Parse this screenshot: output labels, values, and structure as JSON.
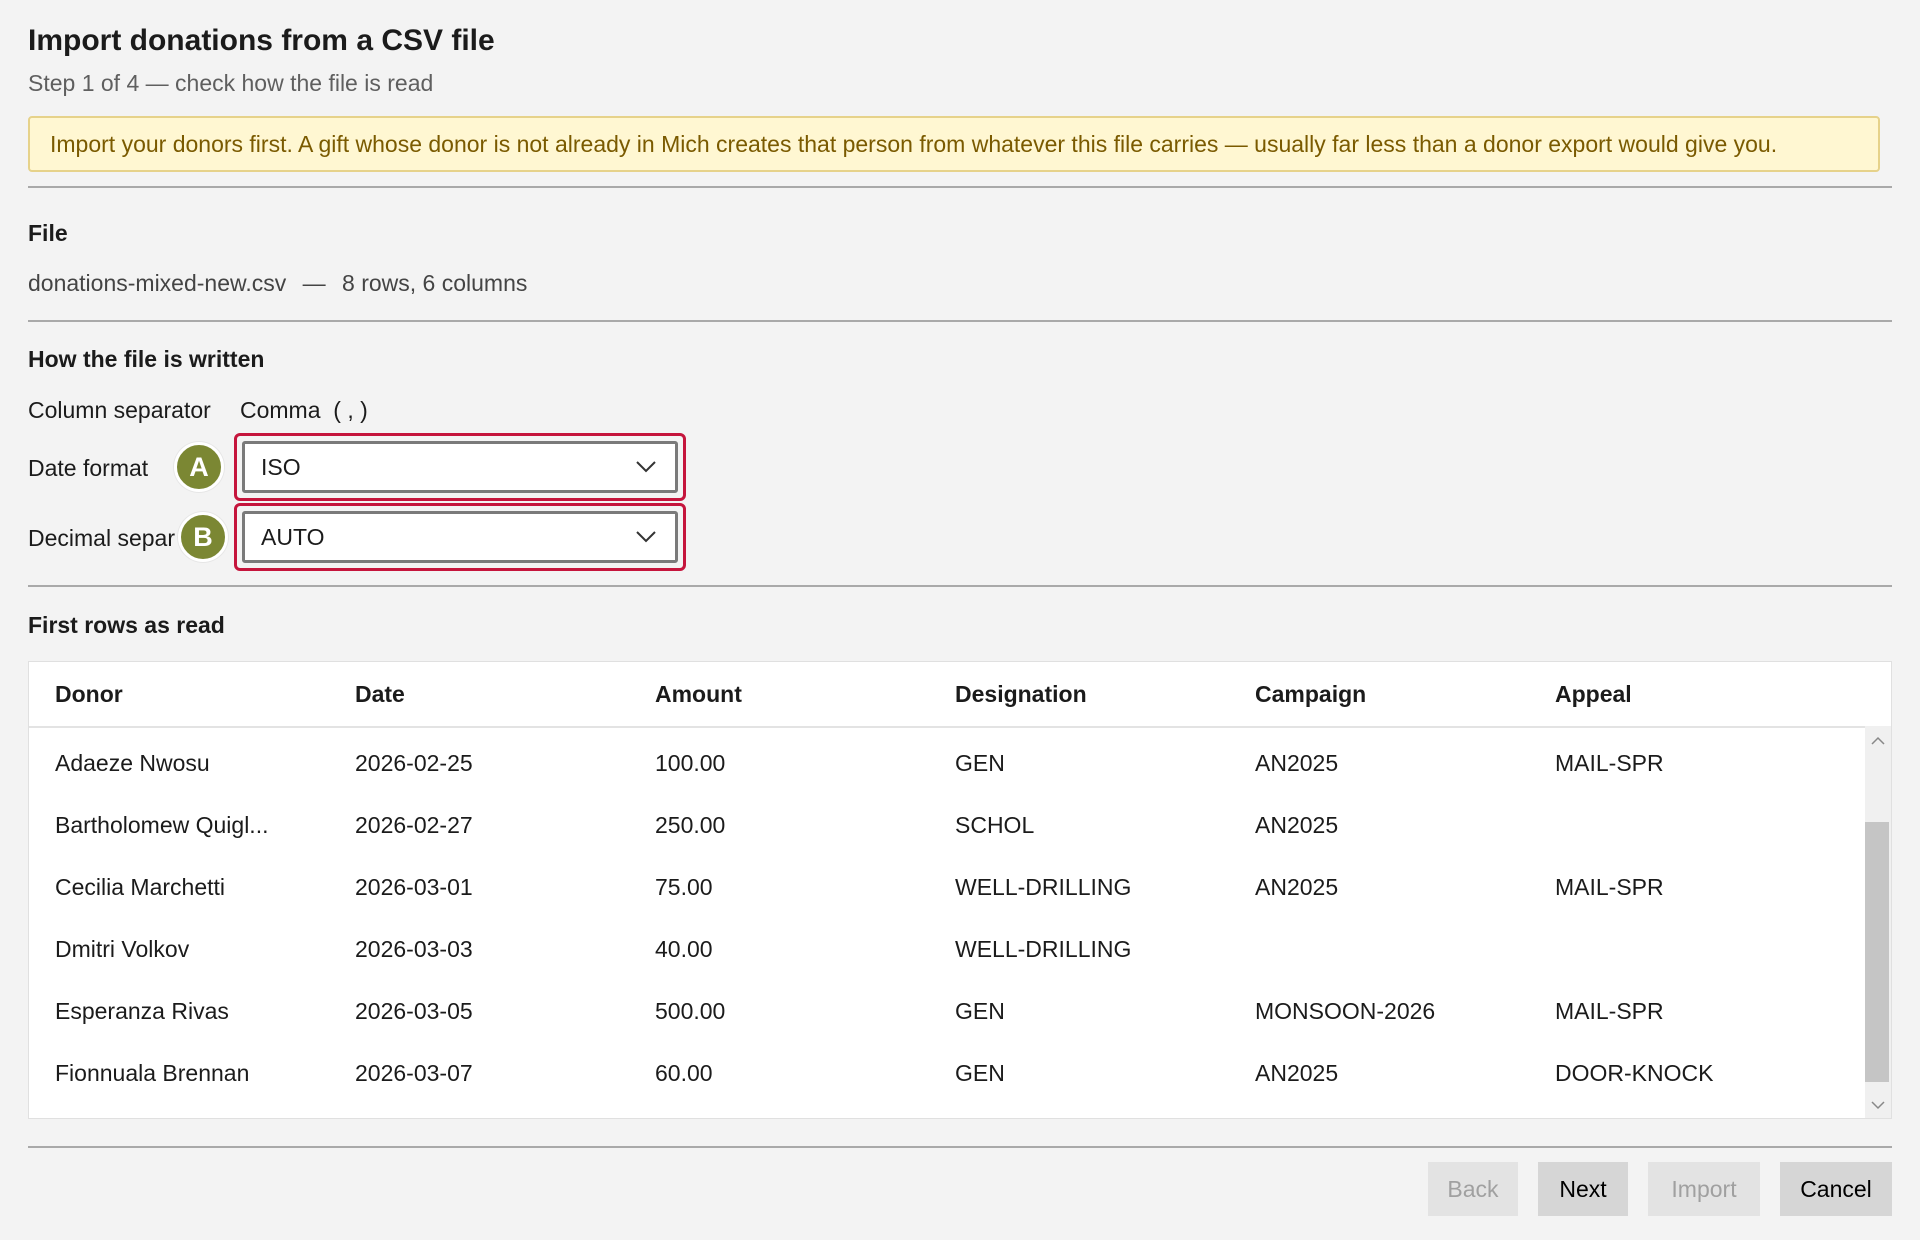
{
  "header": {
    "title": "Import donations from a CSV file",
    "step": "Step 1 of 4 — check how the file is read"
  },
  "notice": "Import your donors first. A gift whose donor is not already in Mich creates that person from whatever this file carries — usually far less than a donor export would give you.",
  "file_section": {
    "heading": "File",
    "filename": "donations-mixed-new.csv",
    "separator": "—",
    "summary": "8 rows, 6 columns"
  },
  "format_section": {
    "heading": "How the file is written",
    "column_separator_label": "Column separator",
    "column_separator_value": "Comma  ( , )",
    "date_format_label": "Date format",
    "date_format_value": "ISO",
    "decimal_separator_label": "Decimal separator",
    "decimal_separator_value": "AUTO"
  },
  "callouts": {
    "a": "A",
    "b": "B",
    "color": "#7b8733",
    "outline_color": "#c5153c"
  },
  "preview": {
    "heading": "First rows as read",
    "columns": [
      "Donor",
      "Date",
      "Amount",
      "Designation",
      "Campaign",
      "Appeal"
    ],
    "rows": [
      [
        "Adaeze Nwosu",
        "2026-02-25",
        "100.00",
        "GEN",
        "AN2025",
        "MAIL-SPR"
      ],
      [
        "Bartholomew Quigl...",
        "2026-02-27",
        "250.00",
        "SCHOL",
        "AN2025",
        ""
      ],
      [
        "Cecilia Marchetti",
        "2026-03-01",
        "75.00",
        "WELL-DRILLING",
        "AN2025",
        "MAIL-SPR"
      ],
      [
        "Dmitri Volkov",
        "2026-03-03",
        "40.00",
        "WELL-DRILLING",
        "",
        ""
      ],
      [
        "Esperanza Rivas",
        "2026-03-05",
        "500.00",
        "GEN",
        "MONSOON-2026",
        "MAIL-SPR"
      ],
      [
        "Fionnuala Brennan",
        "2026-03-07",
        "60.00",
        "GEN",
        "AN2025",
        "DOOR-KNOCK"
      ]
    ]
  },
  "buttons": {
    "back": "Back",
    "next": "Next",
    "import": "Import",
    "cancel": "Cancel"
  },
  "icons": {
    "dropdown": "chevron-down-icon",
    "scroll_up": "chevron-up-icon",
    "scroll_down": "chevron-down-icon"
  }
}
